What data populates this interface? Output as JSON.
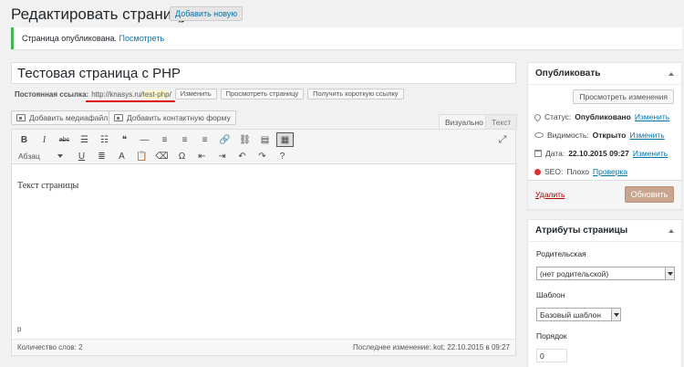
{
  "header": {
    "title": "Редактировать страницу",
    "add_new": "Добавить новую"
  },
  "notice": {
    "text": "Страница опубликована.",
    "link": "Посмотреть"
  },
  "post": {
    "title": "Тестовая страница с PHP",
    "permalink_label": "Постоянная ссылка:",
    "permalink_base": "http://knasys.ru/",
    "permalink_slug": "test-php",
    "permalink_end": "/",
    "edit_btn": "Изменить",
    "view_btn": "Просмотреть страницу",
    "shortlink_btn": "Получить короткую ссылку"
  },
  "media": {
    "add_media": "Добавить медиафайл",
    "add_form": "Добавить контактную форму"
  },
  "editor": {
    "tab_visual": "Визуально",
    "tab_text": "Текст",
    "format_value": "Абзац",
    "content": "Текст страницы",
    "path": "p",
    "word_count": "Количество слов: 2",
    "last_edit": "Последнее изменение: kot; 22.10.2015 в 09:27",
    "row1_icons": [
      {
        "name": "bold-icon",
        "glyph": "B"
      },
      {
        "name": "italic-icon",
        "glyph": "I"
      },
      {
        "name": "strikethrough-icon",
        "glyph": "abc"
      },
      {
        "name": "bulleted-list-icon",
        "glyph": "☰"
      },
      {
        "name": "numbered-list-icon",
        "glyph": "☷"
      },
      {
        "name": "blockquote-icon",
        "glyph": "❝"
      },
      {
        "name": "horizontal-line-icon",
        "glyph": "—"
      },
      {
        "name": "align-left-icon",
        "glyph": "≡"
      },
      {
        "name": "align-center-icon",
        "glyph": "≡"
      },
      {
        "name": "align-right-icon",
        "glyph": "≡"
      },
      {
        "name": "insert-link-icon",
        "glyph": "🔗"
      },
      {
        "name": "remove-link-icon",
        "glyph": "⛓"
      },
      {
        "name": "read-more-icon",
        "glyph": "▤"
      },
      {
        "name": "toolbar-toggle-icon",
        "glyph": "▦"
      }
    ],
    "row2_icons": [
      {
        "name": "underline-icon",
        "glyph": "U"
      },
      {
        "name": "justify-icon",
        "glyph": "≣"
      },
      {
        "name": "text-color-icon",
        "glyph": "A"
      },
      {
        "name": "paste-text-icon",
        "glyph": "📋"
      },
      {
        "name": "clear-formatting-icon",
        "glyph": "⌫"
      },
      {
        "name": "special-character-icon",
        "glyph": "Ω"
      },
      {
        "name": "outdent-icon",
        "glyph": "⇤"
      },
      {
        "name": "indent-icon",
        "glyph": "⇥"
      },
      {
        "name": "undo-icon",
        "glyph": "↶"
      },
      {
        "name": "redo-icon",
        "glyph": "↷"
      },
      {
        "name": "help-icon",
        "glyph": "?"
      }
    ]
  },
  "publish": {
    "title": "Опубликовать",
    "preview_btn": "Просмотреть изменения",
    "status_label": "Статус:",
    "status_value": "Опубликовано",
    "visibility_label": "Видимость:",
    "visibility_value": "Открыто",
    "date_label": "Дата:",
    "date_value": "22.10.2015 09:27",
    "seo_label": "SEO:",
    "seo_value": "Плохо",
    "seo_link": "Проверка",
    "edit_link": "Изменить",
    "delete": "Удалить",
    "update": "Обновить"
  },
  "attributes": {
    "title": "Атрибуты страницы",
    "parent_label": "Родительская",
    "parent_value": "(нет родительской)",
    "template_label": "Шаблон",
    "template_value": "Базовый шаблон",
    "order_label": "Порядок",
    "order_value": "0"
  }
}
